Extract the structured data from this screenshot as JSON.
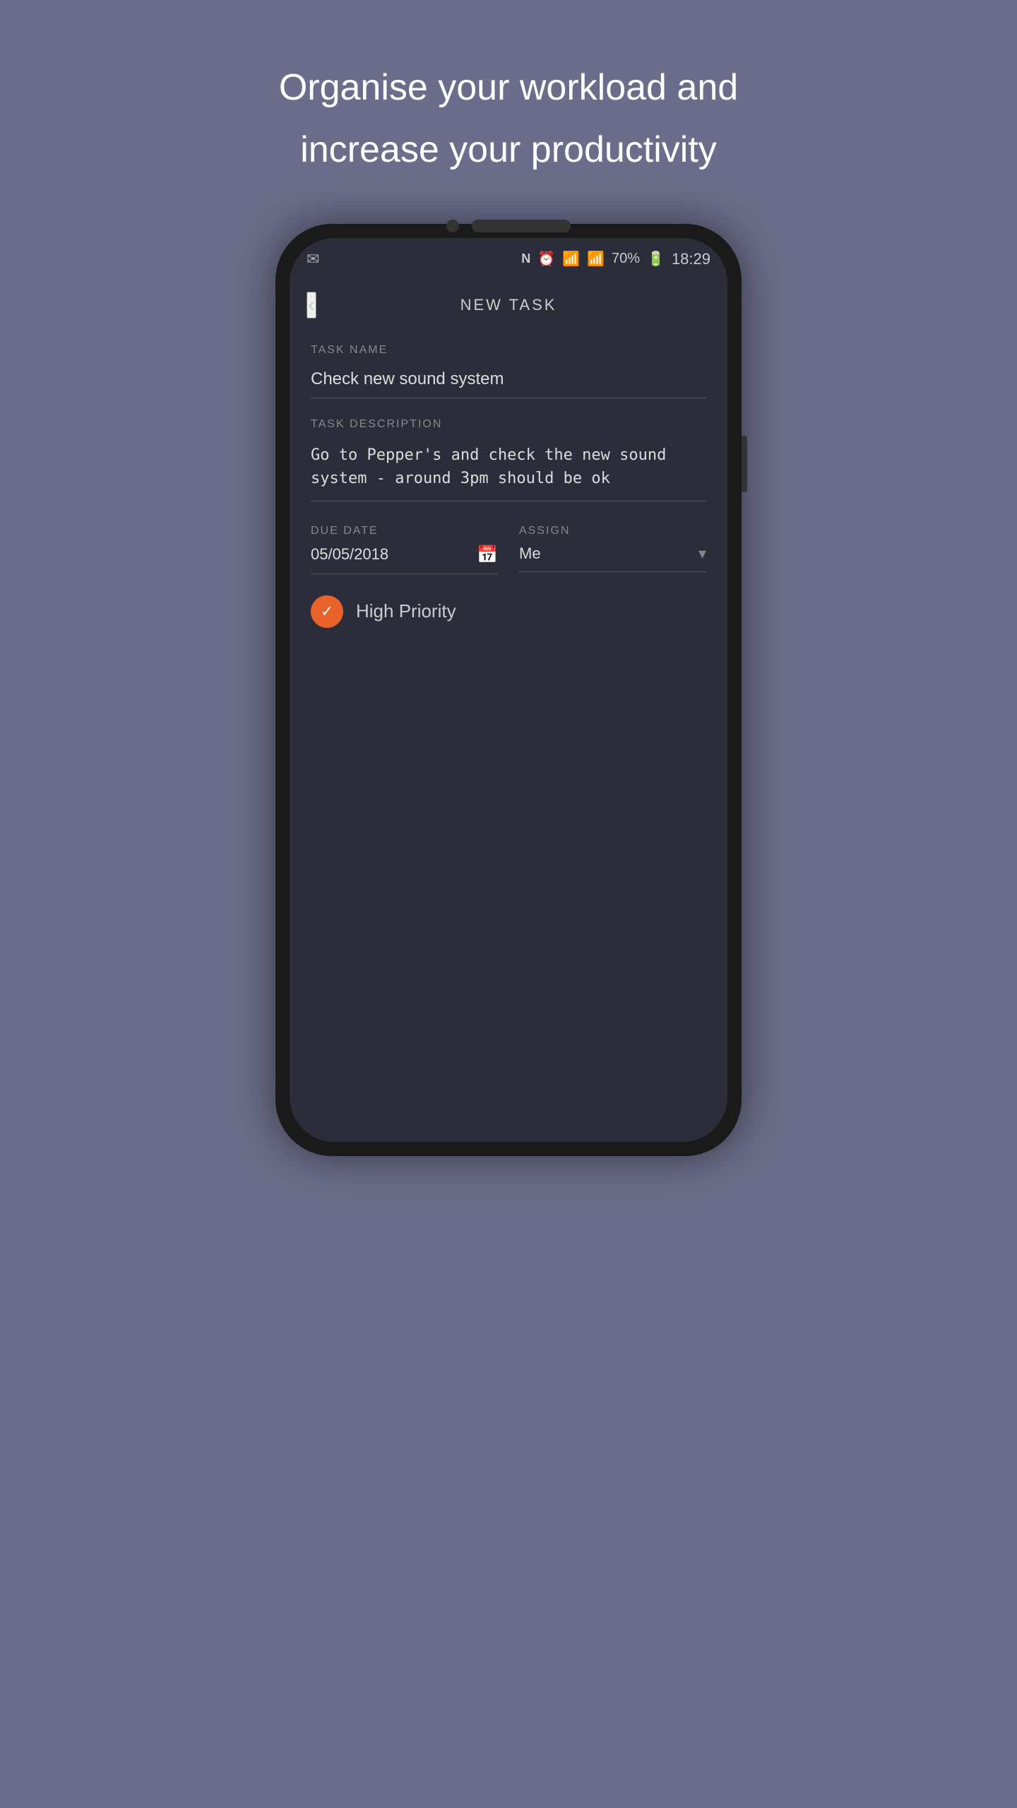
{
  "page": {
    "headline_line1": "Organise your workload and",
    "headline_line2": "increase your productivity"
  },
  "status_bar": {
    "battery": "70%",
    "time": "18:29",
    "icons": [
      "N",
      "⏰",
      "📶",
      "📶"
    ]
  },
  "nav": {
    "back_label": "‹",
    "title": "NEW TASK"
  },
  "form": {
    "task_name_label": "TASK NAME",
    "task_name_value": "Check new sound system",
    "task_desc_label": "TASK DESCRIPTION",
    "task_desc_value": "Go to Pepper's and check the new sound system - around 3pm should be ok",
    "due_date_label": "DUE DATE",
    "due_date_value": "05/05/2018",
    "assign_label": "ASSIGN",
    "assign_value": "Me",
    "priority_label": "High Priority",
    "priority_checked": true
  }
}
